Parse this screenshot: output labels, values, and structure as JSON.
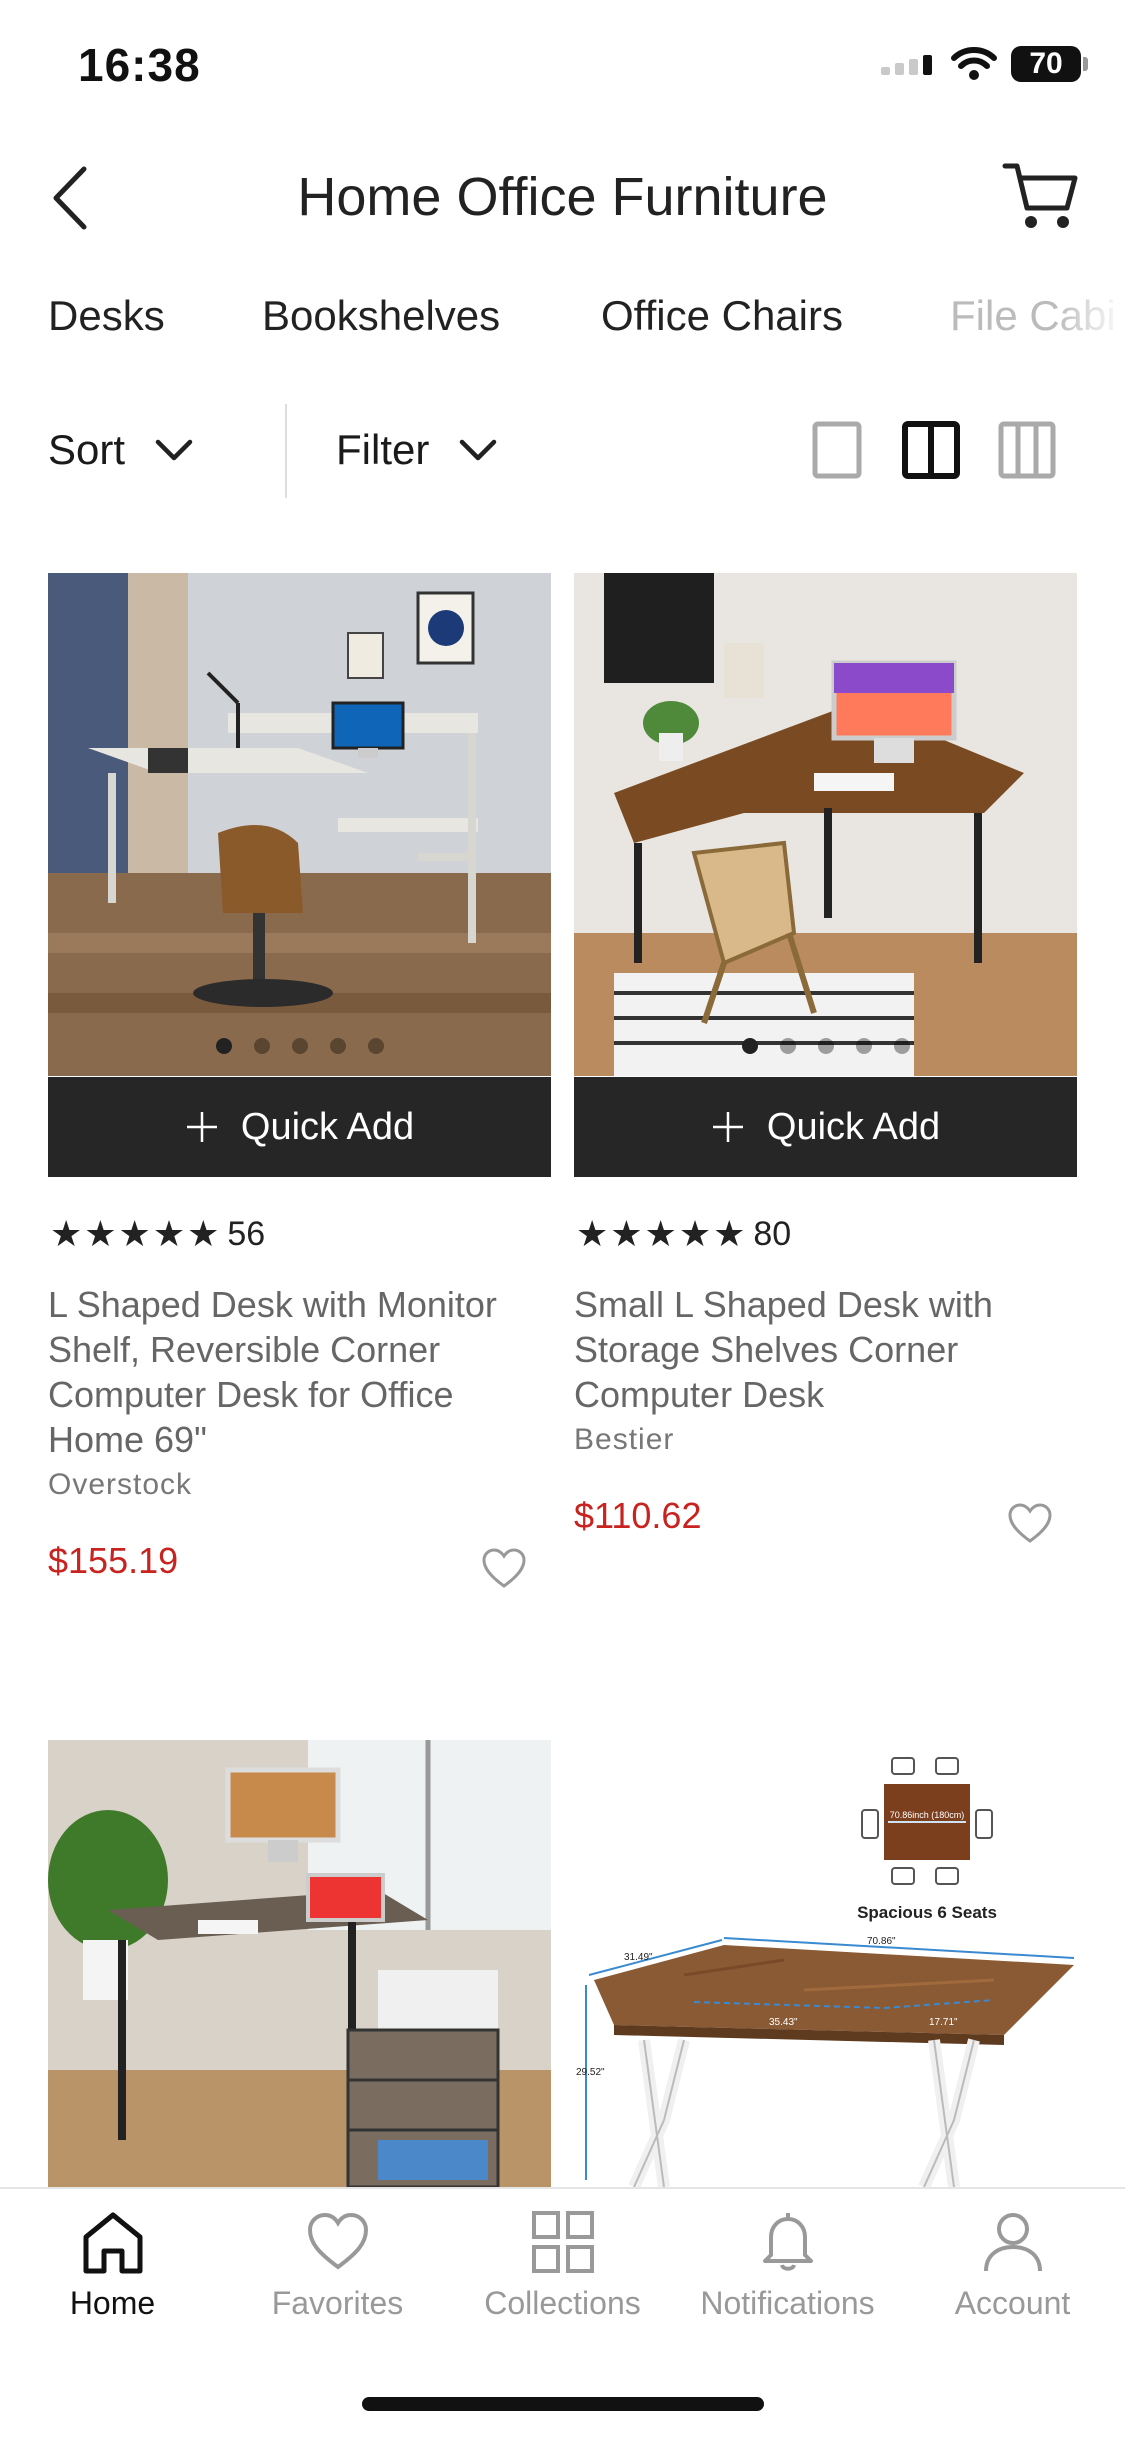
{
  "status_bar": {
    "time": "16:38",
    "battery": "70"
  },
  "header": {
    "title": "Home Office Furniture",
    "back_icon": "chevron-left-icon",
    "cart_icon": "cart-icon"
  },
  "tabs": [
    "Desks",
    "Bookshelves",
    "Office Chairs",
    "File Cabi"
  ],
  "toolbar": {
    "sort_label": "Sort",
    "filter_label": "Filter",
    "view_options": [
      "single-column",
      "two-column",
      "three-column"
    ],
    "selected_view": "two-column"
  },
  "products": [
    {
      "rating_count": "56",
      "stars": 5,
      "title_lines": [
        "L Shaped Desk with Monitor",
        "Shelf, Reversible Corner",
        "Computer Desk for Office",
        "Home 69\""
      ],
      "brand": "Overstock",
      "price": "$155.19",
      "quick_add": "Quick Add",
      "image_dots": 5
    },
    {
      "rating_count": "80",
      "stars": 5,
      "title_lines": [
        "Small L Shaped Desk with",
        "Storage Shelves Corner",
        "Computer Desk"
      ],
      "brand": "Bestier",
      "price": "$110.62",
      "quick_add": "Quick Add",
      "image_dots": 5
    },
    {
      "image": "desk-with-printer-and-drawers"
    },
    {
      "image": "dining-table-dimension-diagram",
      "image_caption": "Spacious 6 Seats",
      "dimension_labels": [
        "70.86\"",
        "31.49\"",
        "35.43\"",
        "17.71\"",
        "29.52\"",
        "70.86inch (180cm)"
      ]
    }
  ],
  "bottom_nav": [
    {
      "label": "Home",
      "icon": "home-icon",
      "active": true
    },
    {
      "label": "Favorites",
      "icon": "heart-icon",
      "active": false
    },
    {
      "label": "Collections",
      "icon": "grid-icon",
      "active": false
    },
    {
      "label": "Notifications",
      "icon": "bell-icon",
      "active": false
    },
    {
      "label": "Account",
      "icon": "person-icon",
      "active": false
    }
  ],
  "colors": {
    "price": "#c8231f",
    "quick_add_bg": "#262626",
    "muted_text": "#999999"
  }
}
